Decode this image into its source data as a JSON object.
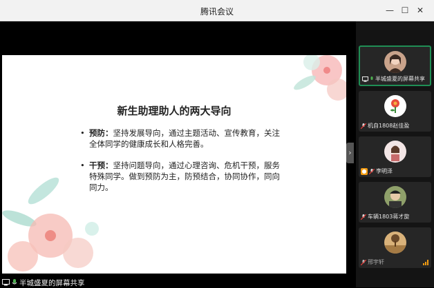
{
  "window": {
    "title": "腾讯会议"
  },
  "slide": {
    "title": "新生助理助人的两大导向",
    "bullets": [
      {
        "label": "预防：",
        "text": "坚持发展导向，通过主题活动、宣传教育，关注全体同学的健康成长和人格完善。"
      },
      {
        "label": "干预：",
        "text": "坚持问题导向，通过心理咨询、危机干预，服务特殊同学。做到预防为主，防预结合，协同协作，同向同力。"
      }
    ]
  },
  "share_bar": {
    "label": "半城盛夏的屏幕共享"
  },
  "participants": [
    {
      "name": "半城盛夏的屏幕共享"
    },
    {
      "name": "机自1808赵佳盈"
    },
    {
      "name": "李明泽"
    },
    {
      "name": "车辆1803蒋才旋"
    },
    {
      "name": "邢宇轩"
    }
  ],
  "colors": {
    "accent": "#1f8f55",
    "muted": "#e53935"
  }
}
